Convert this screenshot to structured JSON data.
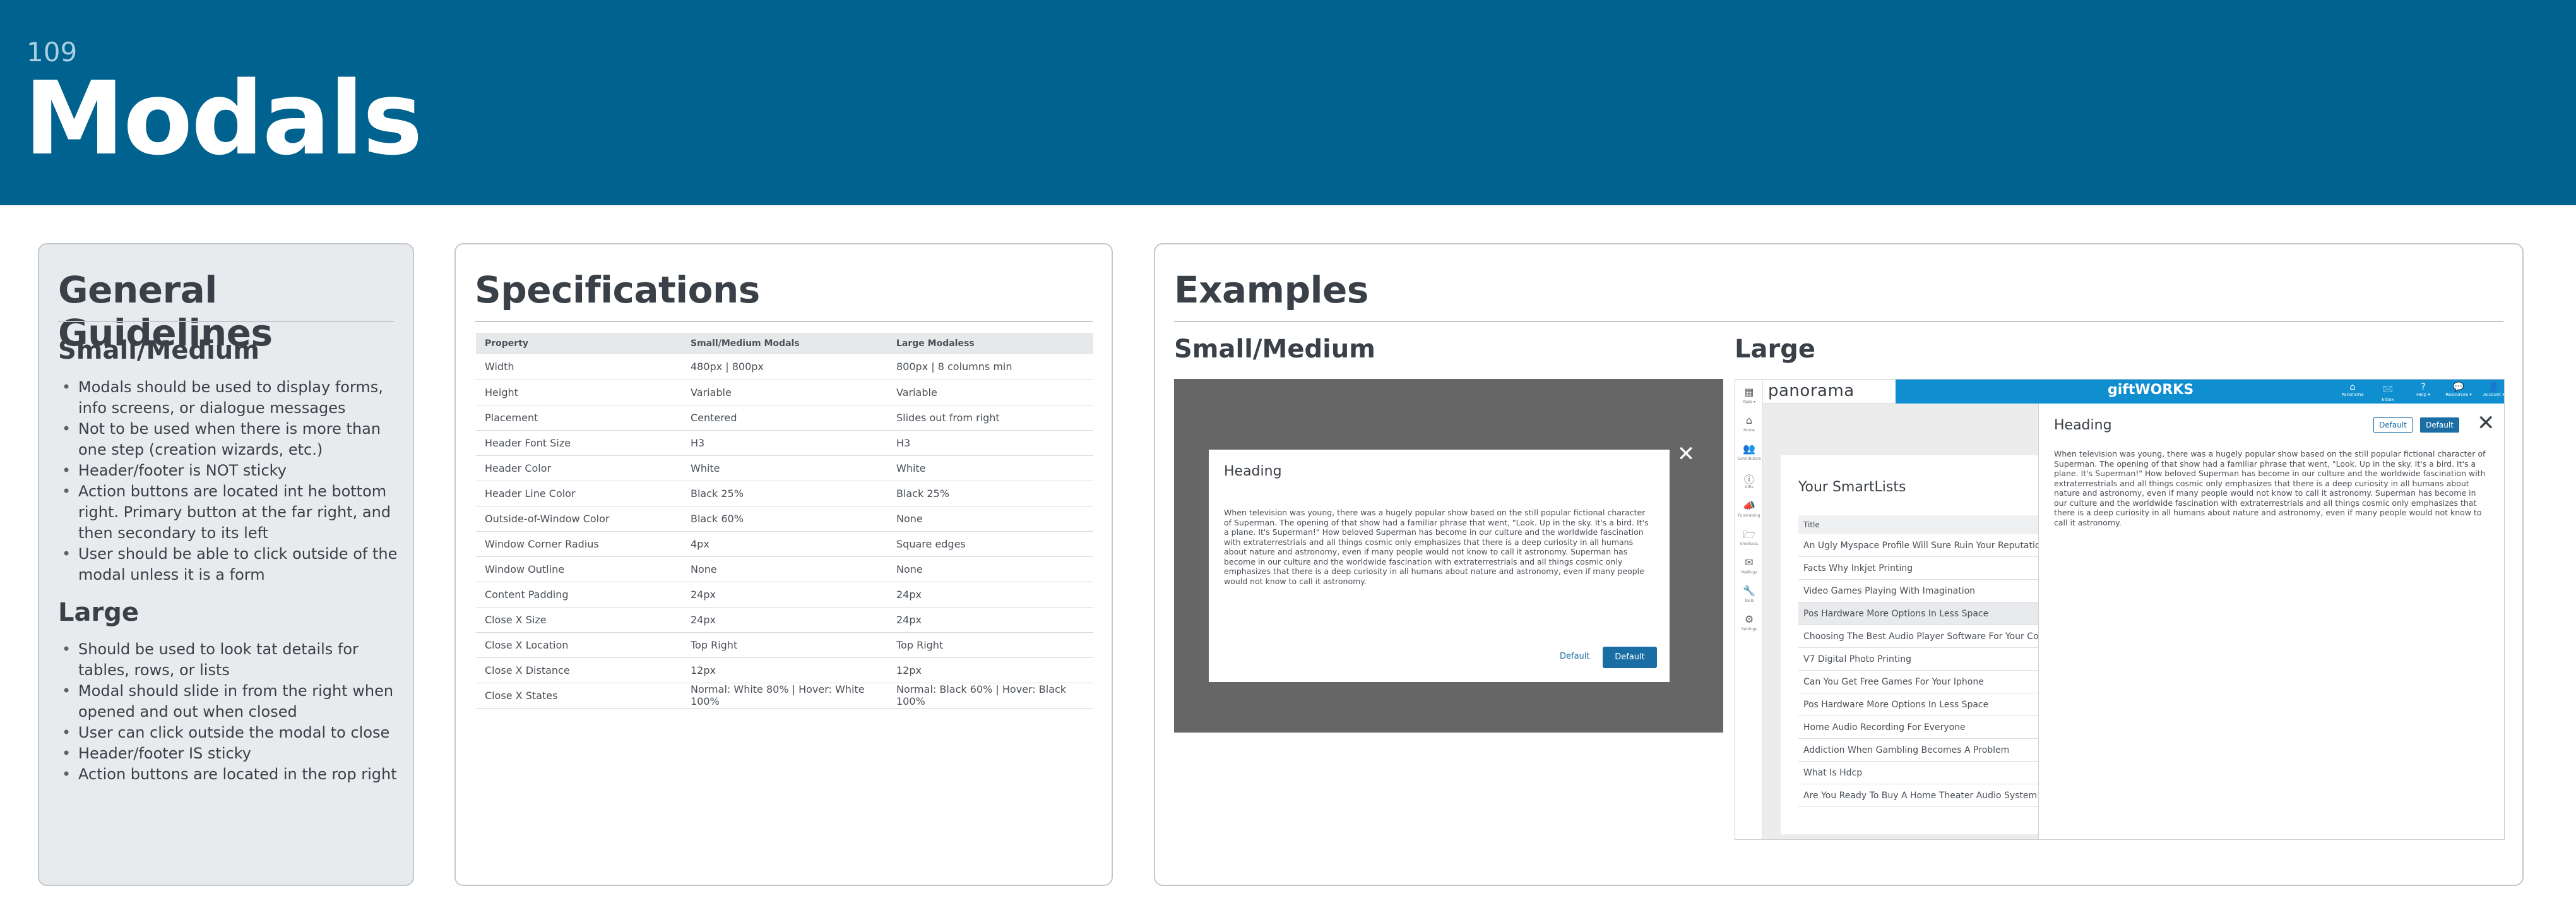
{
  "page": {
    "number": "109",
    "title": "Modals"
  },
  "guidelines": {
    "title": "General Guidelines",
    "small_heading": "Small/Medium",
    "small_items": [
      "Modals should be used to display forms, info screens, or dialogue messages",
      "Not to be used when there is more than one step (creation wizards, etc.)",
      "Header/footer is NOT sticky",
      "Action buttons are located int he bottom right. Primary button at the far right, and then secondary to its left",
      "User should be able to click outside of the modal unless it is a form"
    ],
    "large_heading": "Large",
    "large_items": [
      "Should be used to look tat details for tables, rows, or lists",
      "Modal should slide in from the right when opened and out when closed",
      "User can click outside the modal to close",
      "Header/footer IS sticky",
      "Action buttons are located in the rop right"
    ]
  },
  "specs": {
    "title": "Specifications",
    "headers": [
      "Property",
      "Small/Medium Modals",
      "Large Modaless"
    ],
    "rows": [
      [
        "Width",
        "480px | 800px",
        "800px | 8 columns min"
      ],
      [
        "Height",
        "Variable",
        "Variable"
      ],
      [
        "Placement",
        "Centered",
        "Slides out from right"
      ],
      [
        "Header Font Size",
        "H3",
        "H3"
      ],
      [
        "Header Color",
        "White",
        "White"
      ],
      [
        "Header Line Color",
        "Black 25%",
        "Black 25%"
      ],
      [
        "Outside-of-Window Color",
        "Black 60%",
        "None"
      ],
      [
        "Window Corner Radius",
        "4px",
        "Square edges"
      ],
      [
        "Window Outline",
        "None",
        "None"
      ],
      [
        "Content Padding",
        "24px",
        "24px"
      ],
      [
        "Close X Size",
        "24px",
        "24px"
      ],
      [
        "Close X Location",
        "Top Right",
        "Top Right"
      ],
      [
        "Close X Distance",
        "12px",
        "12px"
      ],
      [
        "Close X States",
        "Normal: White 80% | Hover: White 100%",
        "Normal: Black 60% | Hover: Black 100%"
      ]
    ]
  },
  "examples": {
    "title": "Examples",
    "small_heading": "Small/Medium",
    "large_heading": "Large",
    "modal_heading": "Heading",
    "modal_body": "When television was young, there was a hugely popular show based on the still popular fictional character of Superman. The opening of that show had a familiar phrase that went, \"Look. Up in the sky. It's a bird. It's a plane. It's Superman!\" How beloved Superman has become in our culture and the worldwide fascination with extraterrestrials and all things cosmic only emphasizes that there is a deep curiosity in all humans about nature and astronomy, even if many people would not know to call it astronomy. Superman has become in our culture and the worldwide fascination with extraterrestrials and all things cosmic only emphasizes that there is a deep curiosity in all humans about nature and astronomy, even if many people would not know to call it astronomy.",
    "secondary_label": "Default",
    "primary_label": "Default",
    "close_glyph": "✕",
    "app": {
      "brand": "panorama",
      "product": "giftWORKS",
      "rail": [
        {
          "icon": "▦",
          "label": "Apps ▾"
        },
        {
          "icon": "⌂",
          "label": "Home"
        },
        {
          "icon": "👥",
          "label": "Contributors"
        },
        {
          "icon": "ⓘ",
          "label": "Gifts"
        },
        {
          "icon": "📣",
          "label": "Fundraising"
        },
        {
          "icon": "🗁",
          "label": "Shortcuts"
        },
        {
          "icon": "✉",
          "label": "Mailings"
        },
        {
          "icon": "🔧",
          "label": "Tools"
        },
        {
          "icon": "⚙",
          "label": "Settings"
        }
      ],
      "nav": [
        {
          "icon": "⌂",
          "label": "Panorama"
        },
        {
          "icon": "🖂",
          "label": "Inbox"
        },
        {
          "icon": "?",
          "label": "Help ▾"
        },
        {
          "icon": "💬",
          "label": "Resources ▾"
        },
        {
          "icon": "👤",
          "label": "Account ▾"
        }
      ],
      "list_title": "Your SmartLists",
      "list_header": "Title",
      "list_items": [
        "An Ugly Myspace Profile Will Sure Ruin Your Reputation",
        "Facts Why Inkjet Printing",
        "Video Games Playing With Imagination",
        "Pos Hardware More Options In Less Space",
        "Choosing The Best Audio Player Software For Your Computer",
        "V7 Digital Photo Printing",
        "Can You Get Free Games For Your Iphone",
        "Pos Hardware More Options In Less Space",
        "Home Audio Recording For Everyone",
        "Addiction When Gambling Becomes A Problem",
        "What Is Hdcp",
        "Are You Ready To Buy A Home Theater Audio System"
      ]
    }
  }
}
